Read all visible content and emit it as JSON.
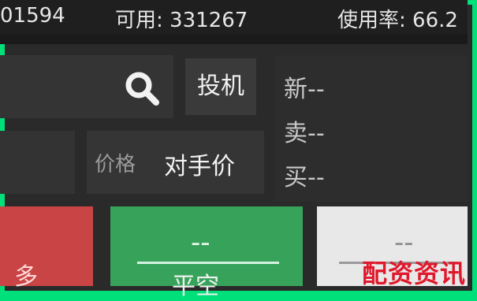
{
  "topbar": {
    "account_number": "01594",
    "available_label": "可用: 331267",
    "usage_label": "使用率: 66.2"
  },
  "search": {
    "value": "",
    "icon": "search-icon"
  },
  "invest_button": "投机",
  "price": {
    "label": "价格",
    "value": "对手价"
  },
  "quotes": {
    "new_label": "新--",
    "sell_label": "卖--",
    "buy_label": "买--"
  },
  "order_buttons": {
    "left_label": "多",
    "middle_top": "--",
    "middle_label": "平空",
    "right_top": "--"
  },
  "watermark": "配资资讯",
  "colors": {
    "border": "#00e07a",
    "red": "#c94444",
    "green": "#37a35a",
    "white": "#e8e8e8",
    "watermark": "#e0182b"
  }
}
